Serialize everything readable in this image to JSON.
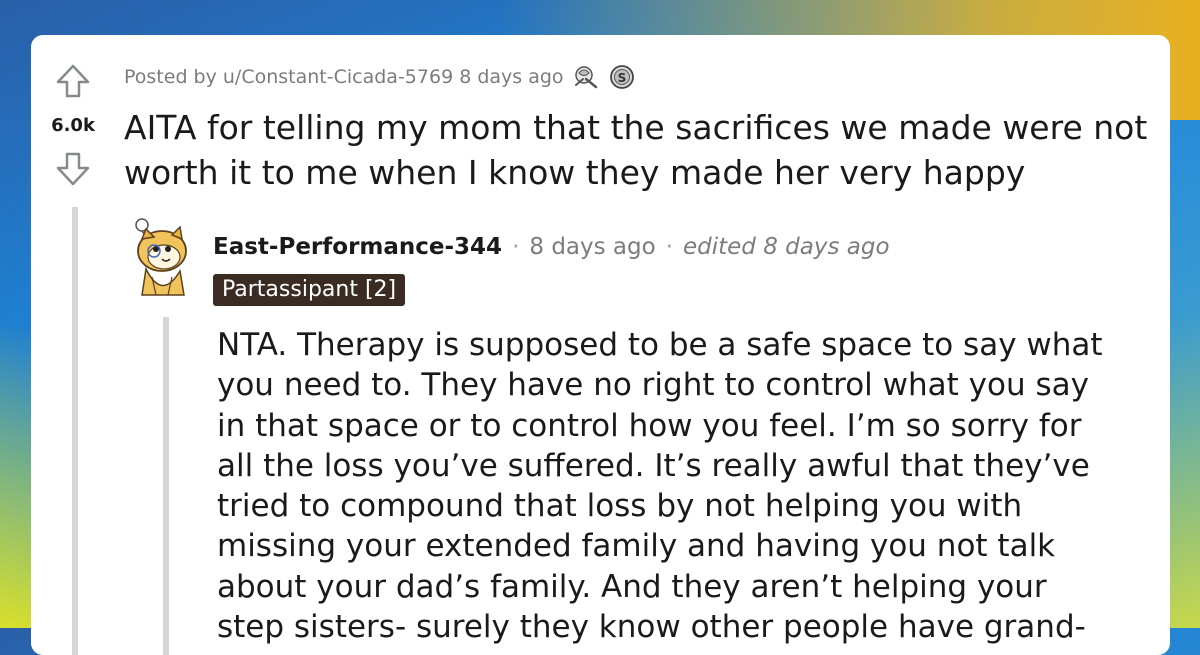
{
  "post": {
    "meta_text": "Posted by u/Constant-Cicada-5769 8 days ago",
    "score": "6.0k",
    "title": "AITA for telling my mom that the sacrifices we made were not worth it to me when I know they made her very happy",
    "awards": [
      "silver-award-icon",
      "coin-award-icon"
    ]
  },
  "comment": {
    "author": "East-Performance-344",
    "separator": "·",
    "time": "8 days ago",
    "edited": "edited 8 days ago",
    "flair": "Partassipant [2]",
    "body": "NTA. Therapy is supposed to be a safe space to say what you need to. They have no right to control what you say in that space or to control how you feel. I’m so sorry for all the loss you’ve suffered. It’s really awful that they’ve tried to compound that loss by not helping you with missing your extended family and having you not talk about your dad’s family. And they aren’t helping your step sisters- surely they know other people have grand-"
  },
  "colors": {
    "text": "#1a1a1b",
    "muted": "#7c7c7c",
    "flair_bg": "#3a2c22",
    "thread_line": "#d6d6d6"
  }
}
